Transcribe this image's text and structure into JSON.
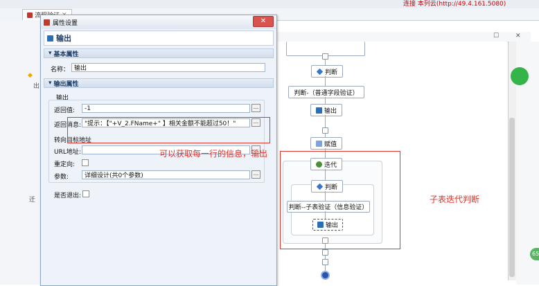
{
  "ide": {
    "tab_title": "流程验证",
    "status_link": "连接 本列云(http://49.4.161.5080)"
  },
  "dialog": {
    "window_title": "属性设置",
    "node_header": "输出",
    "basic_section": "基本属性",
    "name_label": "名称：",
    "name_value": "输出",
    "output_section": "输出属性",
    "output_group": "输出",
    "return_value_label": "返回值:",
    "return_value": "-1",
    "return_msg_label": "返回消息:",
    "return_msg_value": "\"提示：【\"+V_2.FName+\" 】相关金额不能超过50！\"",
    "redirect_group": "转向目标地址",
    "url_label": "URL地址:",
    "url_value": "",
    "redirect_label": "重定向:",
    "params_label": "参数:",
    "params_value": "详细设计(共0个参数)",
    "exit_label": "是否退出:",
    "browse_glyph": "..."
  },
  "flow": {
    "judge1": "判断",
    "judge1_label": "判断-（普通字段验证）",
    "output1": "输出",
    "assign": "赋值",
    "iterate": "迭代",
    "judge2": "判断",
    "judge2_label": "判断--子表验证（信息验证）",
    "output2": "输出"
  },
  "annotations": {
    "left_note": "可以获取每一行的信息，输出",
    "right_note": "子表迭代判断"
  },
  "colors": {
    "annotation_red": "#e0332b",
    "dialog_bg": "#eef3fa",
    "node_border": "#9aa9bc"
  },
  "left_panel": {
    "item1": "出",
    "item2": "迁"
  },
  "badge": "65"
}
